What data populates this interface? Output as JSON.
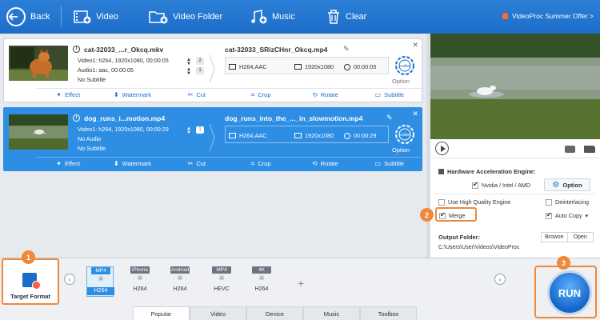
{
  "toolbar": {
    "back": "Back",
    "video": "Video",
    "video_folder": "Video Folder",
    "music": "Music",
    "clear": "Clear",
    "promo": "VideoProc Summer Offer >"
  },
  "items": [
    {
      "name": "cat-32033_...r_Okcq.mkv",
      "video_line": "Video1: h264, 1920x1080, 00:00:05",
      "audio_line": "Audio1: aac, 00:00:05",
      "subtitle_line": "No Subtitle",
      "video_count": "2",
      "audio_count": "1",
      "output_name": "cat-32033_SRizCHnr_Okcq.mp4",
      "codec": "H264,AAC",
      "resolution": "1920x1080",
      "duration": "00:00:05",
      "option": "Option"
    },
    {
      "name": "dog_runs_i...motion.mp4",
      "video_line": "Video1: h264, 1920x1080, 00:00:29",
      "audio_line": "No Audio",
      "subtitle_line": "No Subtitle",
      "video_count": "1",
      "output_name": "dog_runs_into_the_..._in_slowmotion.mp4",
      "codec": "H264,AAC",
      "resolution": "1920x1080",
      "duration": "00:00:29",
      "option": "Option"
    }
  ],
  "edit_bar": {
    "effect": "Effect",
    "watermark": "Watermark",
    "cut": "Cut",
    "crop": "Crop",
    "rotate": "Rotate",
    "subtitle": "Subtitle"
  },
  "settings": {
    "hw_title": "Hardware Acceleration Engine:",
    "nvidia": "Nvidia / Intel / AMD",
    "option": "Option",
    "high_quality": "Use High Quality Engine",
    "deinterlacing": "Deinterlacing",
    "merge": "Merge",
    "auto_copy": "Auto Copy",
    "output_folder": "Output Folder:",
    "browse": "Browse",
    "open": "Open",
    "path": "C:\\Users\\User\\Videos\\VideoProc"
  },
  "callouts": [
    "1",
    "2",
    "3"
  ],
  "target_format": "Target Format",
  "formats": [
    {
      "top": "MP4",
      "bottom": "H264",
      "selected": true
    },
    {
      "top": "iPhone",
      "bottom": "H264"
    },
    {
      "top": "Android",
      "bottom": "H264"
    },
    {
      "top": "MP4",
      "bottom": "HEVC"
    },
    {
      "top": "4K",
      "bottom": "H264"
    }
  ],
  "tabs": [
    "Popular",
    "Video",
    "Device",
    "Music",
    "Toolbox"
  ],
  "run": "RUN",
  "colors": {
    "primary": "#1c6dc9",
    "selected_row": "#2e8ee3",
    "callout": "#f0883a"
  }
}
